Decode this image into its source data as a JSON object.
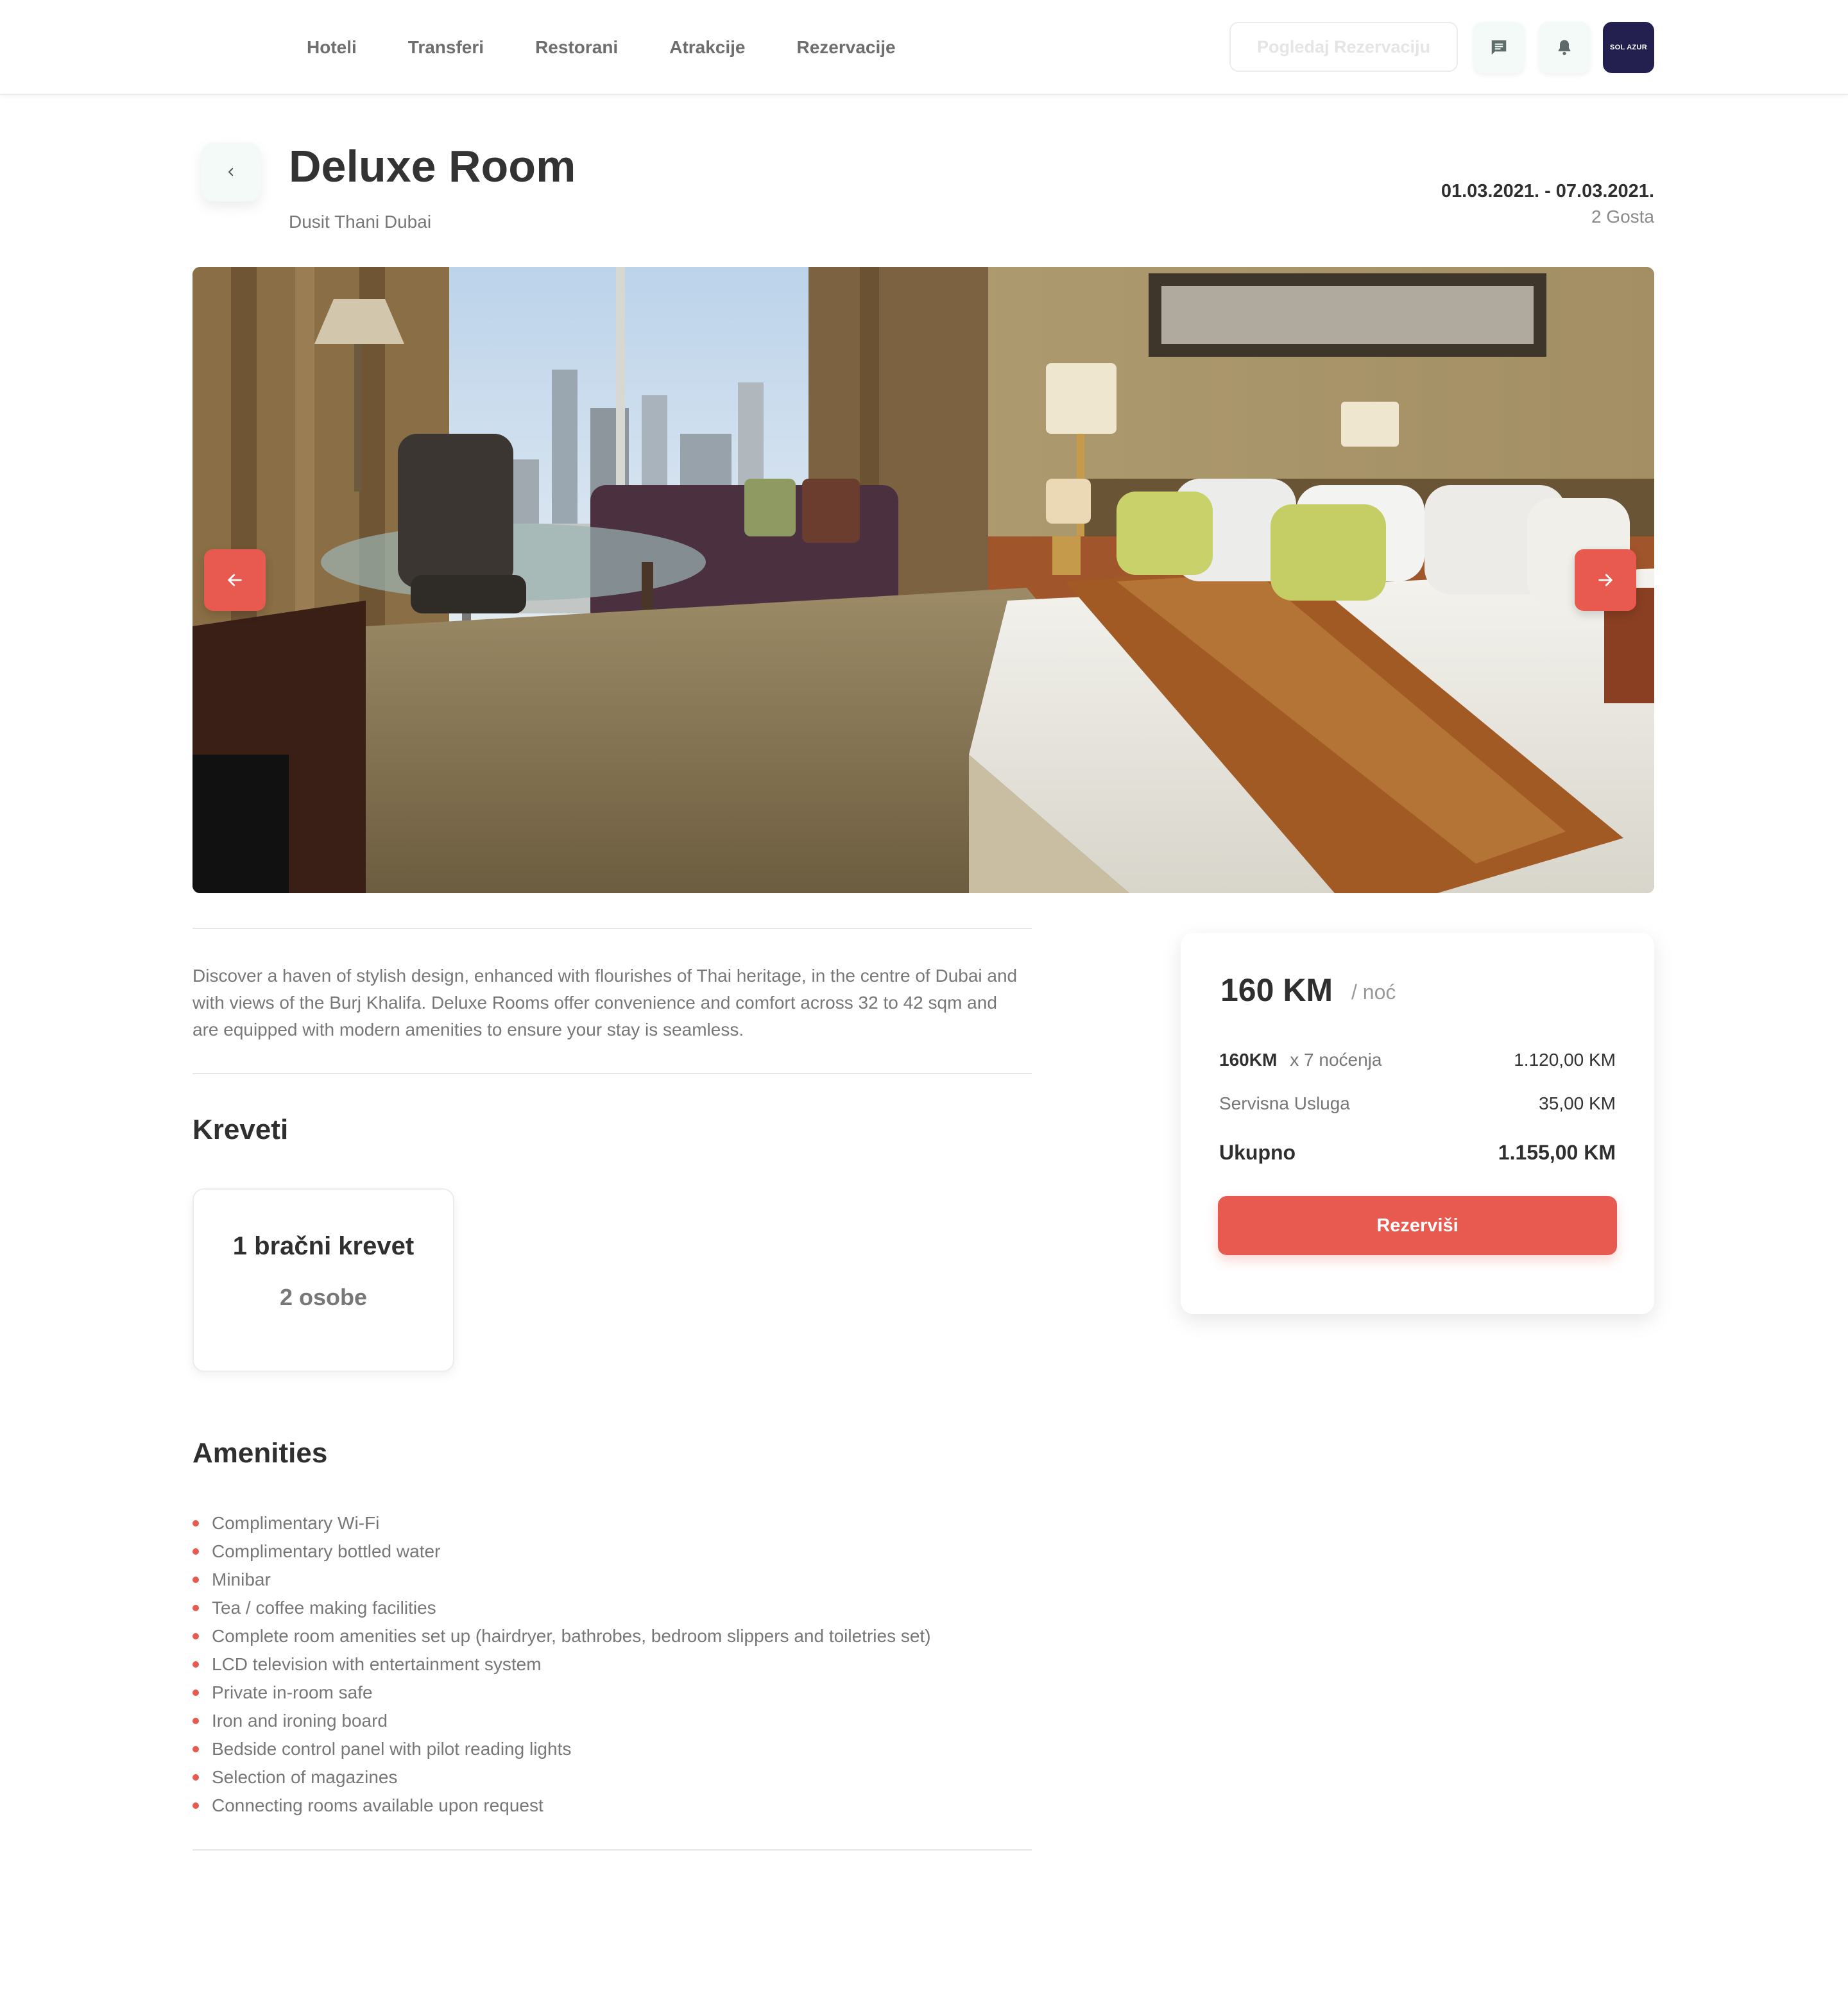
{
  "nav": {
    "items": [
      {
        "label": "Hoteli"
      },
      {
        "label": "Transferi"
      },
      {
        "label": "Restorani"
      },
      {
        "label": "Atrakcije"
      },
      {
        "label": "Rezervacije"
      }
    ],
    "view_reservation_label": "Pogledaj Rezervaciju",
    "icons": [
      "chat-icon",
      "bell-icon"
    ],
    "brand_logo_text": "SOL AZUR"
  },
  "room": {
    "title": "Deluxe Room",
    "hotel": "Dusit Thani Dubai",
    "dates": "01.03.2021. - 07.03.2021.",
    "guests": "2 Gosta",
    "description": "Discover a haven of stylish design, enhanced with flourishes of Thai heritage, in the centre of Dubai and with views of the Burj Khalifa. Deluxe Rooms offer convenience and comfort across 32 to 42 sqm and are equipped with modern amenities to ensure your stay is seamless."
  },
  "beds": {
    "heading": "Kreveti",
    "items": [
      {
        "type": "1 bračni krevet",
        "capacity": "2 osobe"
      }
    ]
  },
  "amenities": {
    "heading": "Amenities",
    "items": [
      "Complimentary Wi-Fi",
      "Complimentary bottled water",
      "Minibar",
      "Tea / coffee making facilities",
      "Complete room amenities set up (hairdryer, bathrobes, bedroom slippers and toiletries set)",
      "LCD television with entertainment system",
      "Private in-room safe",
      "Iron and ironing board",
      "Bedside control panel with pilot reading lights",
      "Selection of magazines",
      "Connecting rooms available upon request"
    ]
  },
  "pricing": {
    "price": "160 KM",
    "per": "/ noć",
    "nightly_rate": "160KM",
    "nights": "x 7 noćenja",
    "nights_total": "1.120,00 KM",
    "service_label": "Servisna Usluga",
    "service_value": "35,00 KM",
    "total_label": "Ukupno",
    "total_value": "1.155,00 KM",
    "reserve_label": "Rezerviši"
  },
  "colors": {
    "accent": "#e85a50",
    "icon_bg": "#f3faf8",
    "brand_dark": "#23204f"
  }
}
